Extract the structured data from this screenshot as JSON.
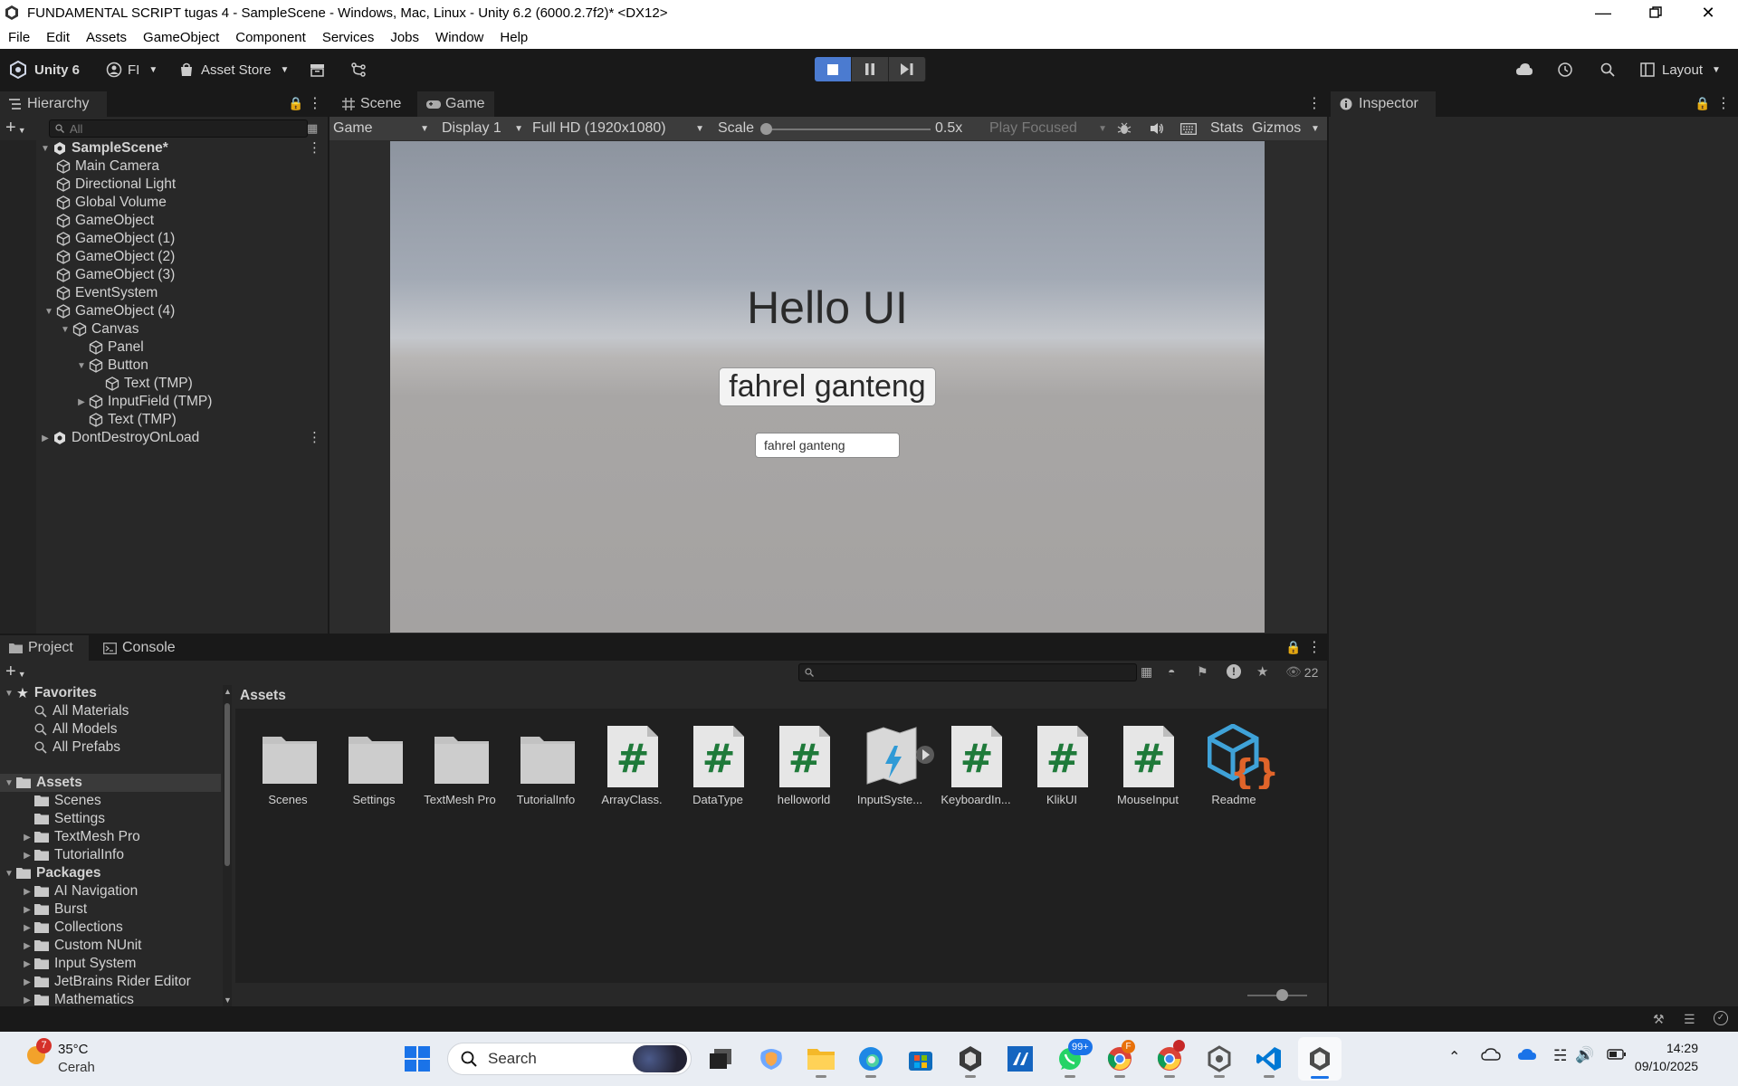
{
  "window": {
    "title": "FUNDAMENTAL SCRIPT tugas 4 - SampleScene - Windows, Mac, Linux - Unity 6.2 (6000.2.7f2)* <DX12>"
  },
  "menu": [
    "File",
    "Edit",
    "Assets",
    "GameObject",
    "Component",
    "Services",
    "Jobs",
    "Window",
    "Help"
  ],
  "toolbar": {
    "account_label": "Unity 6",
    "user_label": "FI",
    "asset_store_label": "Asset Store",
    "layout_label": "Layout"
  },
  "hierarchy": {
    "tab_label": "Hierarchy",
    "search_placeholder": "All",
    "scene_name": "SampleScene*",
    "items": [
      "Main Camera",
      "Directional Light",
      "Global Volume",
      "GameObject",
      "GameObject (1)",
      "GameObject (2)",
      "GameObject (3)",
      "EventSystem",
      "GameObject (4)",
      "Canvas",
      "Panel",
      "Button",
      "Text (TMP)",
      "InputField (TMP)",
      "Text (TMP)"
    ],
    "dont_destroy_label": "DontDestroyOnLoad"
  },
  "game_view": {
    "tab_scene": "Scene",
    "tab_game": "Game",
    "mode_select": "Game",
    "display_select": "Display 1",
    "resolution_select": "Full HD (1920x1080)",
    "scale_label": "Scale",
    "scale_value": "0.5x",
    "scale_fraction": 0.02,
    "play_focused": "Play Focused",
    "stats_label": "Stats",
    "gizmos_label": "Gizmos",
    "hello_text": "Hello UI",
    "button_text": "fahrel ganteng",
    "input_text": "fahrel ganteng"
  },
  "inspector": {
    "tab_label": "Inspector"
  },
  "project": {
    "tab_project": "Project",
    "tab_console": "Console",
    "hidden_count": "22",
    "breadcrumb": "Assets",
    "favorites_label": "Favorites",
    "favorites": [
      "All Materials",
      "All Models",
      "All Prefabs"
    ],
    "assets_label": "Assets",
    "asset_folders": [
      "Scenes",
      "Settings",
      "TextMesh Pro",
      "TutorialInfo"
    ],
    "packages_label": "Packages",
    "packages": [
      "AI Navigation",
      "Burst",
      "Collections",
      "Custom NUnit",
      "Input System",
      "JetBrains Rider Editor",
      "Mathematics"
    ],
    "grid_items": [
      {
        "label": "Scenes",
        "kind": "folder"
      },
      {
        "label": "Settings",
        "kind": "folder"
      },
      {
        "label": "TextMesh Pro",
        "kind": "folder"
      },
      {
        "label": "TutorialInfo",
        "kind": "folder"
      },
      {
        "label": "ArrayClass.",
        "kind": "script"
      },
      {
        "label": "DataType",
        "kind": "script"
      },
      {
        "label": "helloworld",
        "kind": "script"
      },
      {
        "label": "InputSyste...",
        "kind": "input-actions"
      },
      {
        "label": "KeyboardIn...",
        "kind": "script"
      },
      {
        "label": "KlikUI",
        "kind": "script"
      },
      {
        "label": "MouseInput",
        "kind": "script"
      },
      {
        "label": "Readme",
        "kind": "readme"
      }
    ]
  },
  "taskbar": {
    "weather_temp": "35°C",
    "weather_desc": "Cerah",
    "weather_badge": "7",
    "search_label": "Search",
    "whatsapp_badge": "99+",
    "time": "14:29",
    "date": "09/10/2025"
  },
  "colors": {
    "accent_blue": "#4b7bd0",
    "script_hash_green": "#1f7a3a",
    "readme_orange": "#e0642a",
    "readme_blue": "#3fa2d8"
  }
}
